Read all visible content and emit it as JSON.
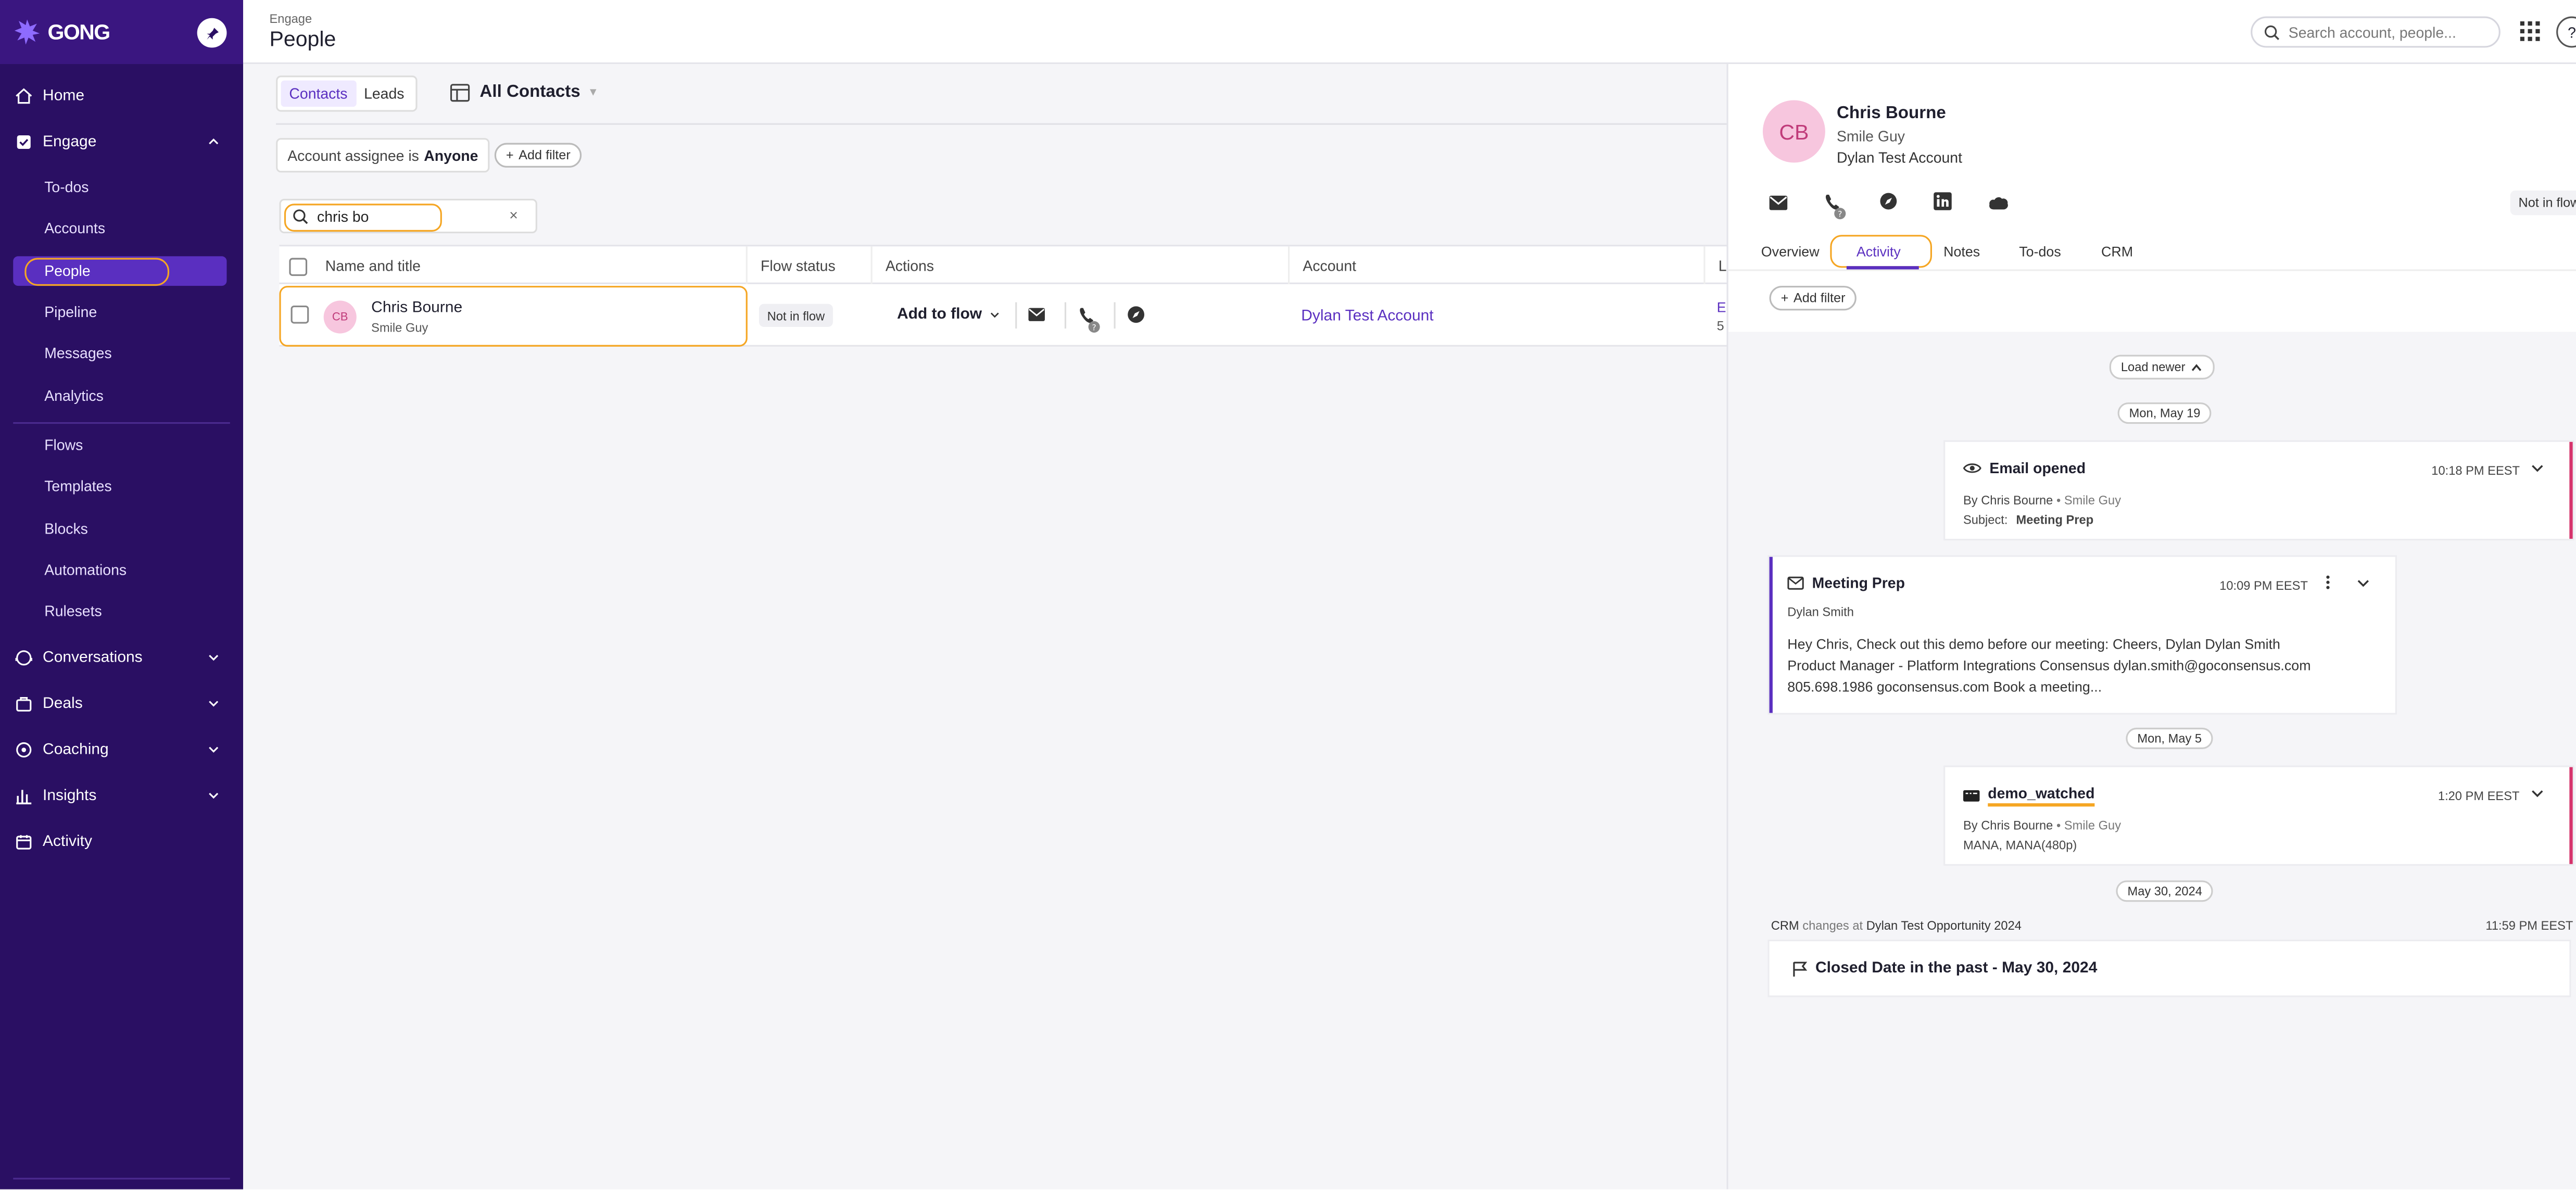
{
  "sidebar": {
    "logo": "GONG",
    "items": [
      {
        "label": "Home",
        "icon": "home-icon"
      },
      {
        "label": "Engage",
        "icon": "engage-icon"
      },
      {
        "label": "Conversations",
        "icon": "conversations-icon"
      },
      {
        "label": "Deals",
        "icon": "deals-icon"
      },
      {
        "label": "Coaching",
        "icon": "coaching-icon"
      },
      {
        "label": "Insights",
        "icon": "insights-icon"
      },
      {
        "label": "Activity",
        "icon": "activity-icon"
      }
    ],
    "engage_sub": [
      "To-dos",
      "Accounts",
      "People",
      "Pipeline",
      "Messages",
      "Analytics"
    ],
    "engage_sub2": [
      "Flows",
      "Templates",
      "Blocks",
      "Automations",
      "Rulesets"
    ],
    "active": "People",
    "colors": {
      "bg": "#2a0f63",
      "active": "#5a2fc0",
      "highlight": "#f5a623"
    }
  },
  "header": {
    "breadcrumb": "Engage",
    "title": "People",
    "search_placeholder": "Search account, people...",
    "help": "?"
  },
  "main": {
    "toggle": [
      "Contacts",
      "Leads"
    ],
    "view_name": "All Contacts",
    "filter_prefix": "Account assignee is",
    "filter_value": "Anyone",
    "add_filter": "Add filter",
    "search_value": "chris bo",
    "clear": "×",
    "columns": [
      "Name and title",
      "Flow status",
      "Actions",
      "Account",
      "L"
    ],
    "row": {
      "initials": "CB",
      "name": "Chris Bourne",
      "title": "Smile Guy",
      "flow_status": "Not in flow",
      "action": "Add to flow",
      "account": "Dylan Test Account",
      "last_1": "E",
      "last_2": "5"
    }
  },
  "panel": {
    "initials": "CB",
    "name": "Chris Bourne",
    "title": "Smile Guy",
    "account": "Dylan Test Account",
    "flow_status": "Not in flow",
    "tabs": [
      "Overview",
      "Activity",
      "Notes",
      "To-dos",
      "CRM"
    ],
    "active_tab": "Activity",
    "add_filter": "Add filter",
    "load_newer": "Load newer",
    "timeline": {
      "date1": "Mon, May 19",
      "email_opened": {
        "title": "Email opened",
        "time": "10:18 PM EEST",
        "by_prefix": "By",
        "by": "Chris Bourne",
        "role": "Smile Guy",
        "subject_label": "Subject:",
        "subject": "Meeting Prep"
      },
      "meeting_prep": {
        "title": "Meeting Prep",
        "time": "10:09 PM EEST",
        "from": "Dylan Smith",
        "body_1": "Hey Chris, Check out this demo before our meeting: Cheers, Dylan Dylan Smith",
        "body_2": "Product Manager - Platform Integrations Consensus dylan.smith@goconsensus.com",
        "body_3": "805.698.1986 goconsensus.com Book a meeting..."
      },
      "date2": "Mon, May 5",
      "demo": {
        "title": "demo_watched",
        "time": "1:20 PM EEST",
        "by_prefix": "By",
        "by": "Chris Bourne",
        "role": "Smile Guy",
        "detail": "MANA, MANA(480p)"
      },
      "date3": "May 30, 2024",
      "crm": {
        "prefix": "CRM",
        "mid": "changes at",
        "target": "Dylan Test Opportunity 2024",
        "time": "11:59 PM EEST",
        "closed": "Closed Date in the past - May 30, 2024"
      }
    }
  }
}
